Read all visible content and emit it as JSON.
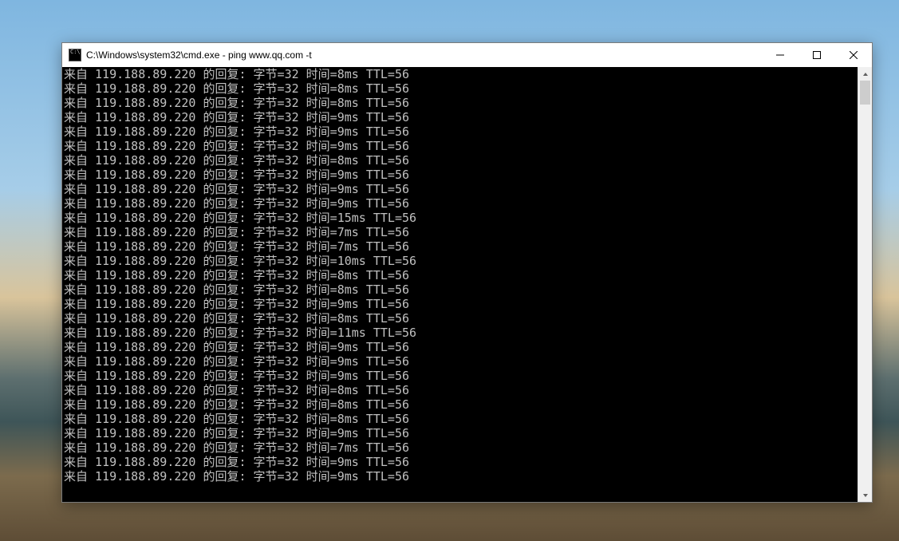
{
  "window": {
    "title": "C:\\Windows\\system32\\cmd.exe - ping  www.qq.com -t"
  },
  "ping": {
    "ip": "119.188.89.220",
    "prefix": "来自 ",
    "reply_label": " 的回复: ",
    "bytes_label": "字节=32",
    "time_label_prefix": "时间=",
    "time_label_suffix": "ms",
    "ttl_label": "TTL=56",
    "times_ms": [
      8,
      8,
      8,
      9,
      9,
      9,
      8,
      9,
      9,
      9,
      15,
      7,
      7,
      10,
      8,
      8,
      9,
      8,
      11,
      9,
      9,
      9,
      8,
      8,
      8,
      9,
      7,
      9,
      9
    ]
  }
}
